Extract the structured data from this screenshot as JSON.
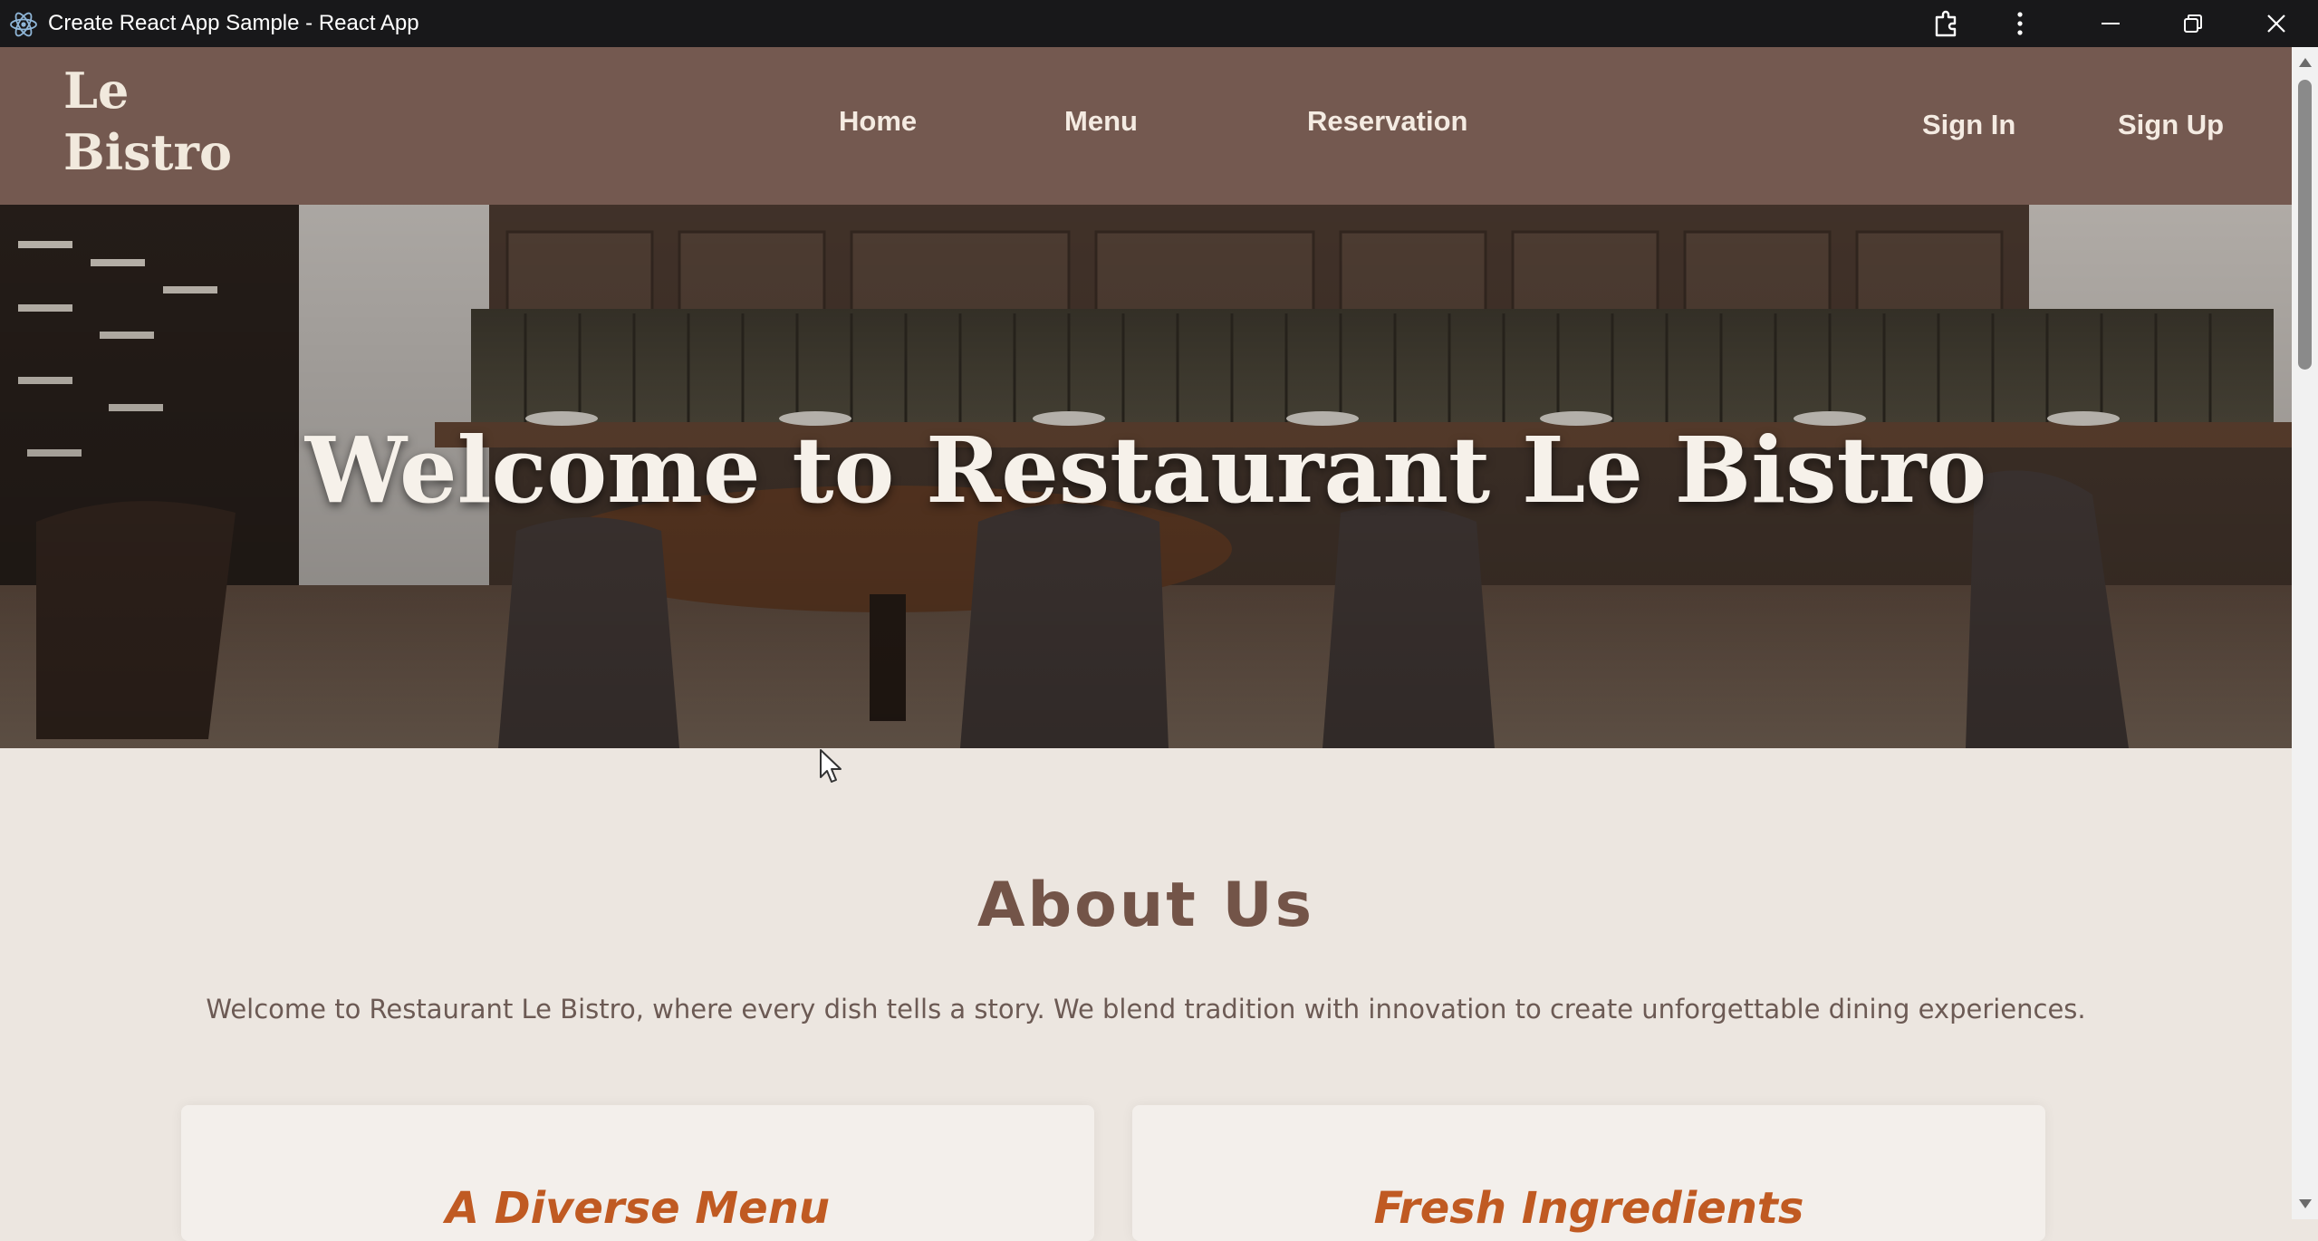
{
  "window": {
    "title": "Create React App Sample - React App",
    "app_icon": "react-icon",
    "controls": [
      "extensions-icon",
      "more-options-icon",
      "minimize-icon",
      "restore-icon",
      "close-icon"
    ]
  },
  "navbar": {
    "logo_line1": "Le",
    "logo_line2": "Bistro",
    "links": {
      "home": "Home",
      "menu": "Menu",
      "reservation": "Reservation"
    },
    "auth": {
      "sign_in": "Sign In",
      "sign_up": "Sign Up"
    }
  },
  "hero": {
    "title": "Welcome to Restaurant Le Bistro"
  },
  "about": {
    "title": "About Us",
    "text": "Welcome to Restaurant Le Bistro, where every dish tells a story. We blend tradition with innovation to create unforgettable dining experiences.",
    "cards": [
      {
        "title": "A Diverse Menu"
      },
      {
        "title": "Fresh Ingredients"
      }
    ]
  },
  "colors": {
    "navbar_bg": "#745950",
    "page_bg": "#ece6e0",
    "about_title": "#735448",
    "card_title": "#c05a22"
  }
}
